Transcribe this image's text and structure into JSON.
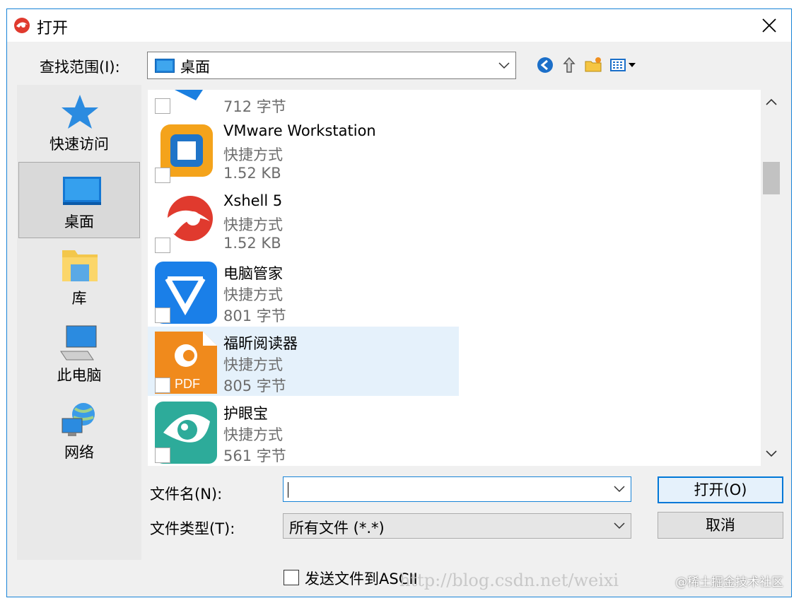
{
  "window": {
    "title": "打开"
  },
  "lookin": {
    "label": "查找范围(I):",
    "value": "桌面"
  },
  "places": [
    {
      "label": "快速访问",
      "icon": "star-icon"
    },
    {
      "label": "桌面",
      "icon": "desktop-icon",
      "selected": true
    },
    {
      "label": "库",
      "icon": "library-folder-icon"
    },
    {
      "label": "此电脑",
      "icon": "computer-icon"
    },
    {
      "label": "网络",
      "icon": "network-globe-icon"
    }
  ],
  "files": [
    {
      "name": "",
      "type": "",
      "size": "712 字节",
      "icon": "blue-arrow-app-icon"
    },
    {
      "name": "VMware Workstation",
      "type": "快捷方式",
      "size": "1.52 KB",
      "icon": "vmware-icon"
    },
    {
      "name": "Xshell 5",
      "type": "快捷方式",
      "size": "1.52 KB",
      "icon": "xshell-icon"
    },
    {
      "name": "电脑管家",
      "type": "快捷方式",
      "size": "801 字节",
      "icon": "pc-manager-icon"
    },
    {
      "name": "福昕阅读器",
      "type": "快捷方式",
      "size": "805 字节",
      "icon": "foxit-pdf-icon",
      "selected": true
    },
    {
      "name": "护眼宝",
      "type": "快捷方式",
      "size": "561 字节",
      "icon": "eye-protect-icon"
    }
  ],
  "filename": {
    "label": "文件名(N):",
    "value": ""
  },
  "filetype": {
    "label": "文件类型(T):",
    "value": "所有文件 (*.*)"
  },
  "buttons": {
    "open": "打开(O)",
    "cancel": "取消"
  },
  "ascii": {
    "label": "发送文件到ASCII",
    "checked": false
  },
  "watermark": {
    "text": "http://blog.csdn.net/weixi",
    "credit": "@稀土掘金技术社区"
  },
  "colors": {
    "accent": "#0078d7",
    "selection": "#e5f1fb",
    "dialog_bg": "#f0f0f0"
  }
}
